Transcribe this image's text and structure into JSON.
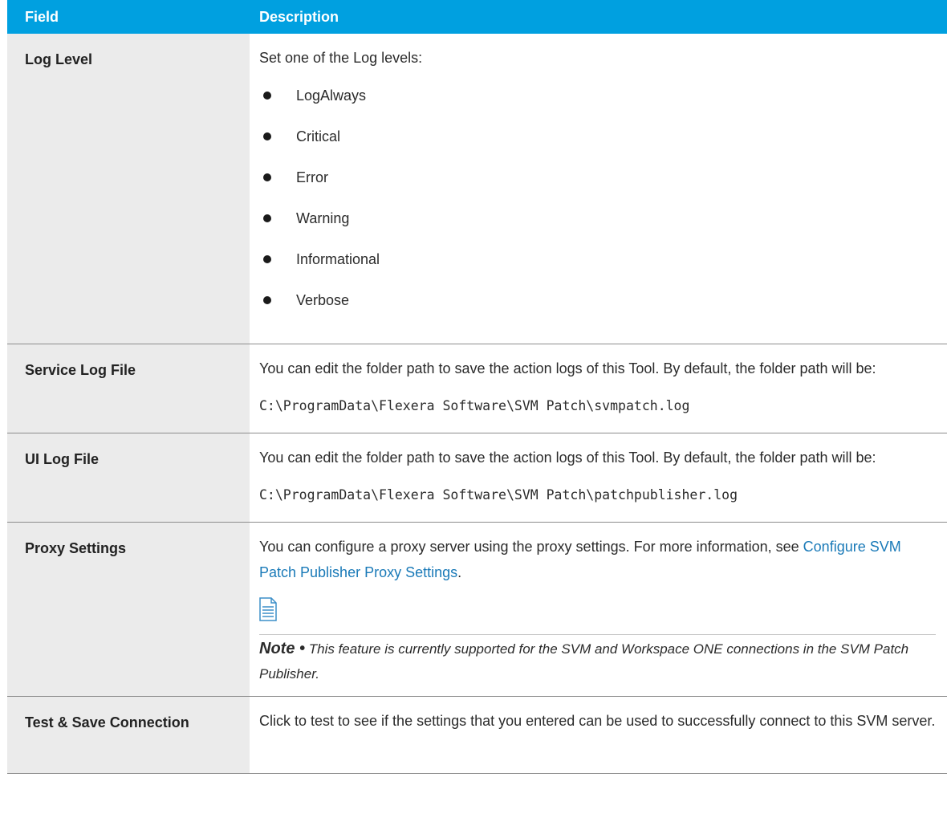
{
  "table": {
    "headers": {
      "field": "Field",
      "description": "Description"
    },
    "rows": {
      "log_level": {
        "field": "Log Level",
        "intro": "Set one of the Log levels:",
        "levels": [
          "LogAlways",
          "Critical",
          "Error",
          "Warning",
          "Informational",
          "Verbose"
        ]
      },
      "service_log": {
        "field": "Service Log File",
        "text": "You can edit the folder path to save the action logs of this Tool. By default, the folder path will be:",
        "path": "C:\\ProgramData\\Flexera Software\\SVM Patch\\svmpatch.log"
      },
      "ui_log": {
        "field": "UI Log File",
        "text": "You can edit the folder path to save the action logs of this Tool. By default, the folder path will be:",
        "path": "C:\\ProgramData\\Flexera Software\\SVM Patch\\patchpublisher.log"
      },
      "proxy": {
        "field": "Proxy Settings",
        "text": "You can configure a proxy server using the proxy settings. For more information, see ",
        "link": "Configure SVM Patch Publisher Proxy Settings",
        "link_suffix": ".",
        "note_icon": "document-note-icon",
        "note_label": "Note •",
        "note_text": " This feature is currently supported for the SVM and Workspace ONE connections in the SVM Patch Publisher."
      },
      "test_save": {
        "field": "Test & Save Connection",
        "text": "Click to test to see if the settings that you entered can be used to successfully connect to this SVM server."
      }
    }
  },
  "colors": {
    "header_bg": "#00a0e0",
    "field_bg": "#ebebeb",
    "link": "#1a7ab8"
  }
}
